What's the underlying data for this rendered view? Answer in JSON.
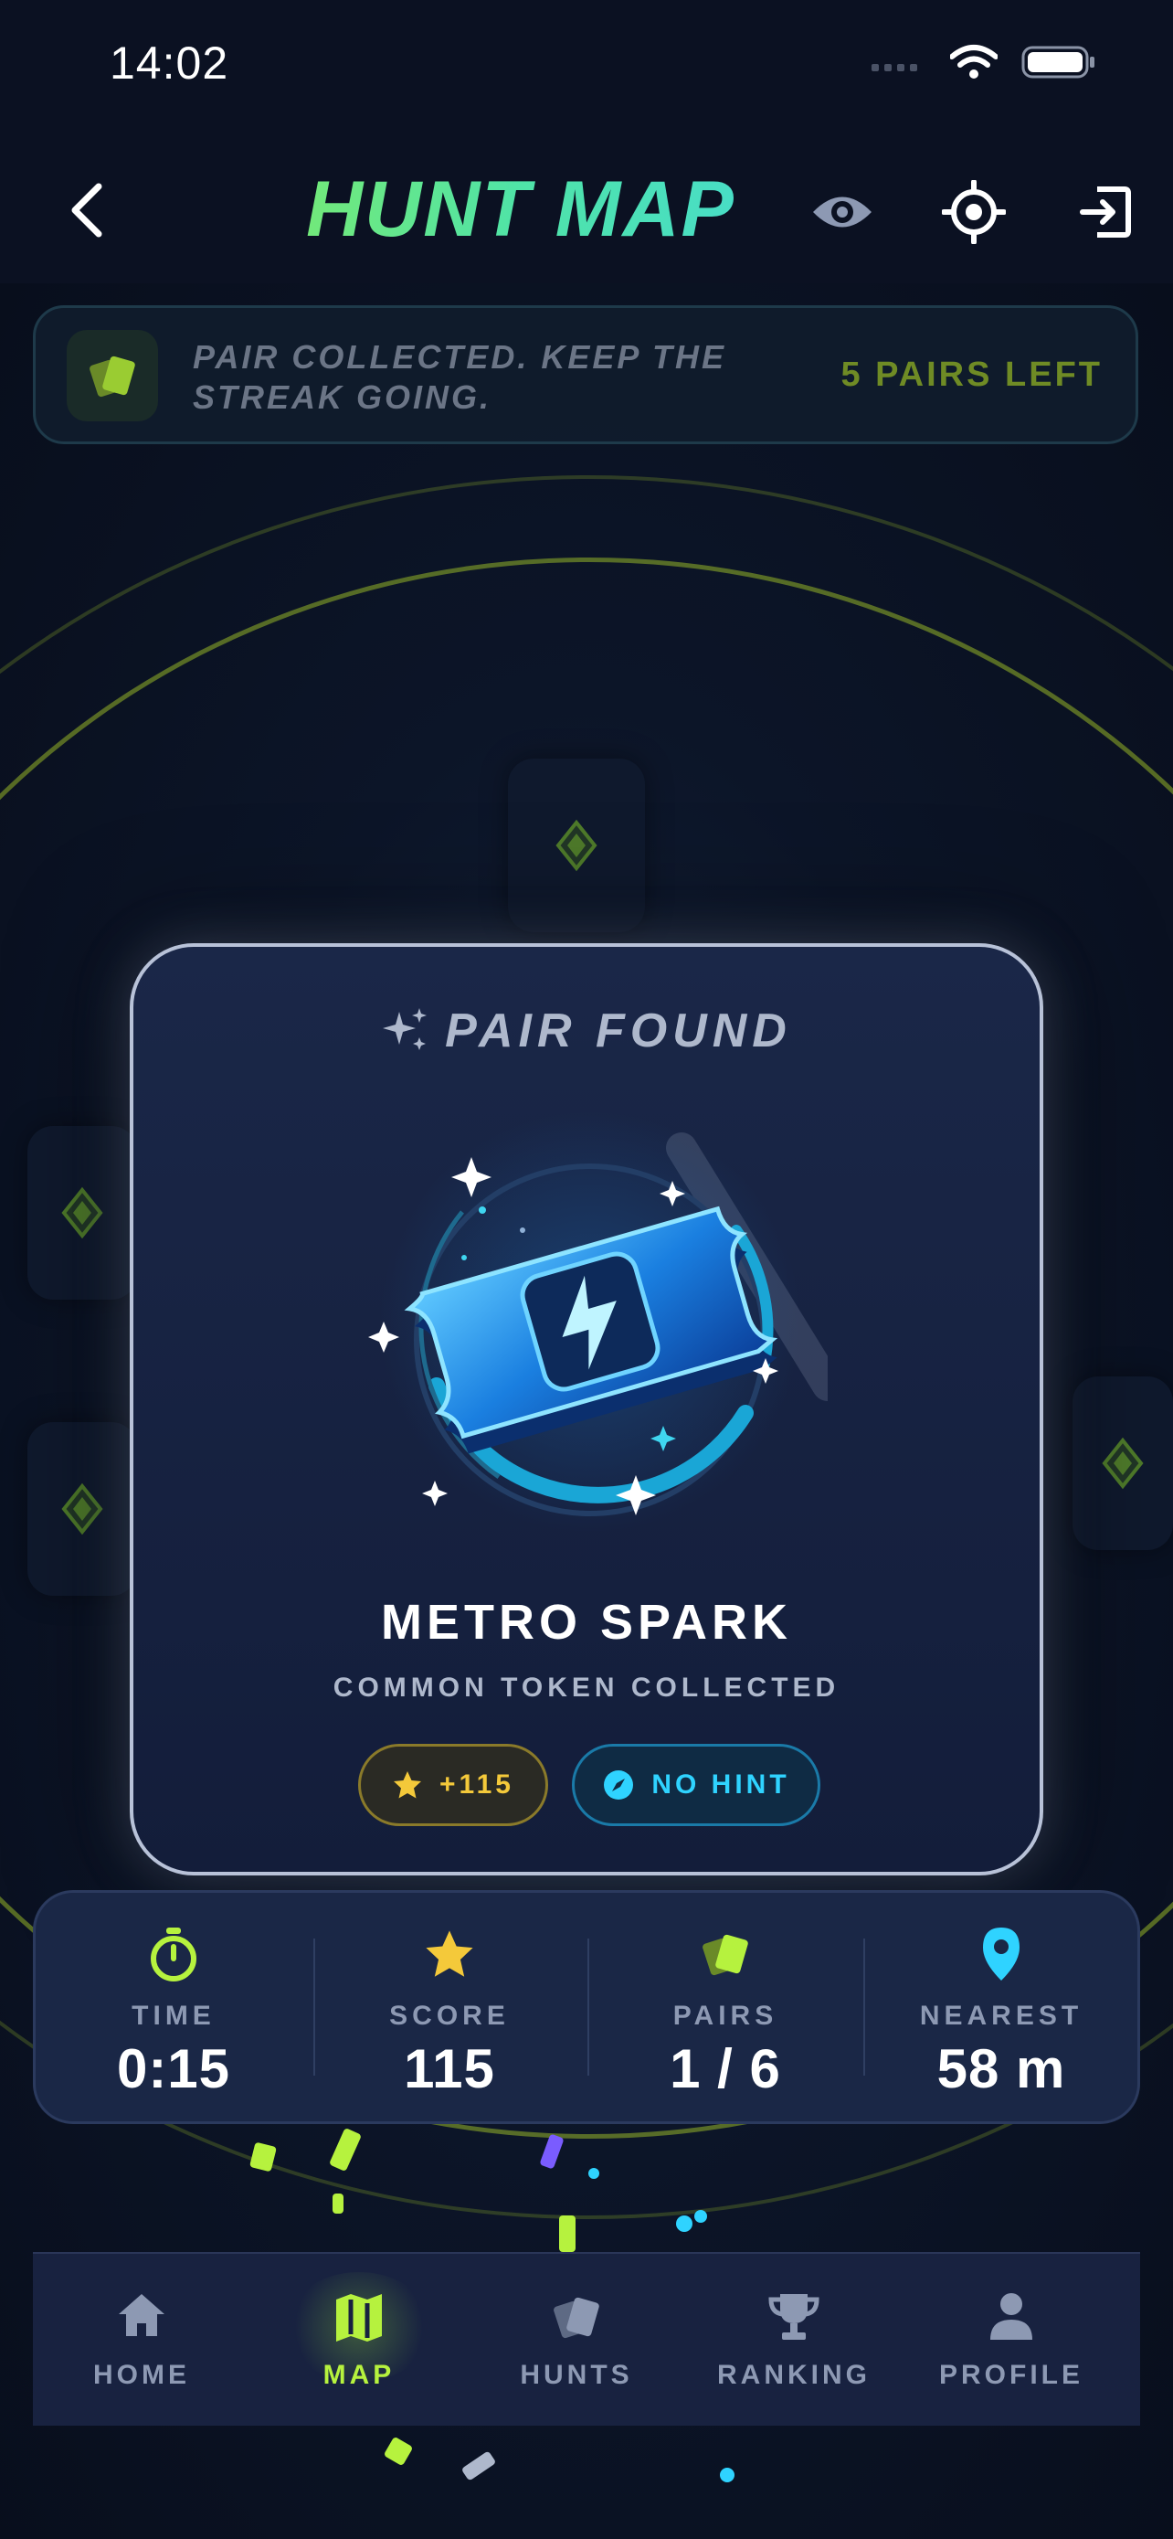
{
  "status": {
    "time": "14:02"
  },
  "header": {
    "title": "HUNT MAP"
  },
  "banner": {
    "message": "PAIR COLLECTED. KEEP THE STREAK GOING.",
    "pairs_left": "5 PAIRS LEFT"
  },
  "modal": {
    "heading": "PAIR FOUND",
    "token_name": "METRO SPARK",
    "token_subtitle": "COMMON TOKEN COLLECTED",
    "score_pill": "+115",
    "hint_pill": "NO HINT"
  },
  "stats": [
    {
      "label": "TIME",
      "value": "0:15",
      "icon": "stopwatch-icon",
      "color": "#b6f23e"
    },
    {
      "label": "SCORE",
      "value": "115",
      "icon": "star-icon",
      "color": "#f4c93a"
    },
    {
      "label": "PAIRS",
      "value": "1 / 6",
      "icon": "cards-icon",
      "color": "#b6f23e"
    },
    {
      "label": "NEAREST",
      "value": "58 m",
      "icon": "location-pin-icon",
      "color": "#2fd3ff"
    }
  ],
  "nav": [
    {
      "label": "HOME",
      "icon": "home-icon",
      "active": false
    },
    {
      "label": "MAP",
      "icon": "map-icon",
      "active": true
    },
    {
      "label": "HUNTS",
      "icon": "cards-icon",
      "active": false
    },
    {
      "label": "RANKING",
      "icon": "trophy-icon",
      "active": false
    },
    {
      "label": "PROFILE",
      "icon": "person-icon",
      "active": false
    }
  ],
  "colors": {
    "accent_lime": "#b6f23e",
    "accent_cyan": "#2fd3ff",
    "accent_gold": "#f4c93a",
    "background": "#0a1020"
  }
}
